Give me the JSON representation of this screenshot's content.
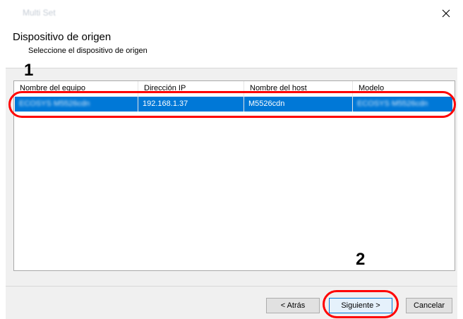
{
  "window": {
    "title": "Multi Set",
    "close_glyph": "×"
  },
  "header": {
    "title": "Dispositivo de origen",
    "subtitle": "Seleccione el dispositivo de origen"
  },
  "list": {
    "columns": [
      "Nombre del equipo",
      "Dirección IP",
      "Nombre del host",
      "Modelo"
    ],
    "rows": [
      {
        "device_name": "ECOSYS M5526cdn",
        "ip": "192.168.1.37",
        "host": "M5526cdn",
        "model": "ECOSYS M5526cdn",
        "selected": true
      }
    ]
  },
  "annotations": {
    "step1": "1",
    "step2": "2"
  },
  "buttons": {
    "back": "< Atrás",
    "next": "Siguiente >",
    "cancel": "Cancelar"
  },
  "colors": {
    "selection": "#0078d7",
    "callout": "#ff0000"
  }
}
